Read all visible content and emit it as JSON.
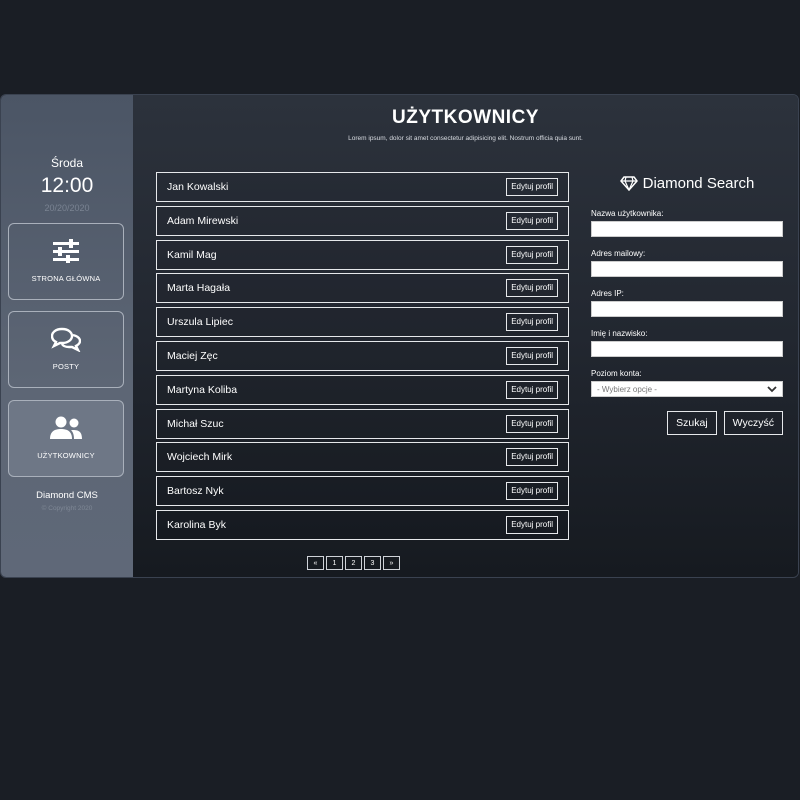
{
  "sidebar": {
    "day": "Środa",
    "time": "12:00",
    "date": "20/20/2020",
    "nav": [
      {
        "label": "STRONA GŁÓWNA",
        "icon": "sliders-icon"
      },
      {
        "label": "POSTY",
        "icon": "chat-bubbles-icon"
      },
      {
        "label": "UŻYTKOWNICY",
        "icon": "users-icon"
      }
    ],
    "brand": "Diamond CMS",
    "copyright": "© Copyright 2020"
  },
  "main": {
    "title": "UŻYTKOWNICY",
    "subtitle": "Lorem ipsum, dolor sit amet consectetur adipisicing elit. Nostrum officia quia sunt.",
    "edit_label": "Edytuj profil",
    "users": [
      {
        "name": "Jan Kowalski"
      },
      {
        "name": "Adam Mirewski"
      },
      {
        "name": "Kamil Mag"
      },
      {
        "name": "Marta Hagała"
      },
      {
        "name": "Urszula Lipiec"
      },
      {
        "name": "Maciej Zęc"
      },
      {
        "name": "Martyna Koliba"
      },
      {
        "name": "Michał Szuc"
      },
      {
        "name": "Wojciech Mirk"
      },
      {
        "name": "Bartosz Nyk"
      },
      {
        "name": "Karolina Byk"
      }
    ],
    "pagination": [
      "«",
      "1",
      "2",
      "3",
      "»"
    ]
  },
  "search": {
    "title": "Diamond Search",
    "username_label": "Nazwa użytkownika:",
    "email_label": "Adres mailowy:",
    "ip_label": "Adres IP:",
    "fullname_label": "Imię i nazwisko:",
    "level_label": "Poziom konta:",
    "level_placeholder": "- Wybierz opcje -",
    "search_button": "Szukaj",
    "clear_button": "Wyczyść"
  }
}
